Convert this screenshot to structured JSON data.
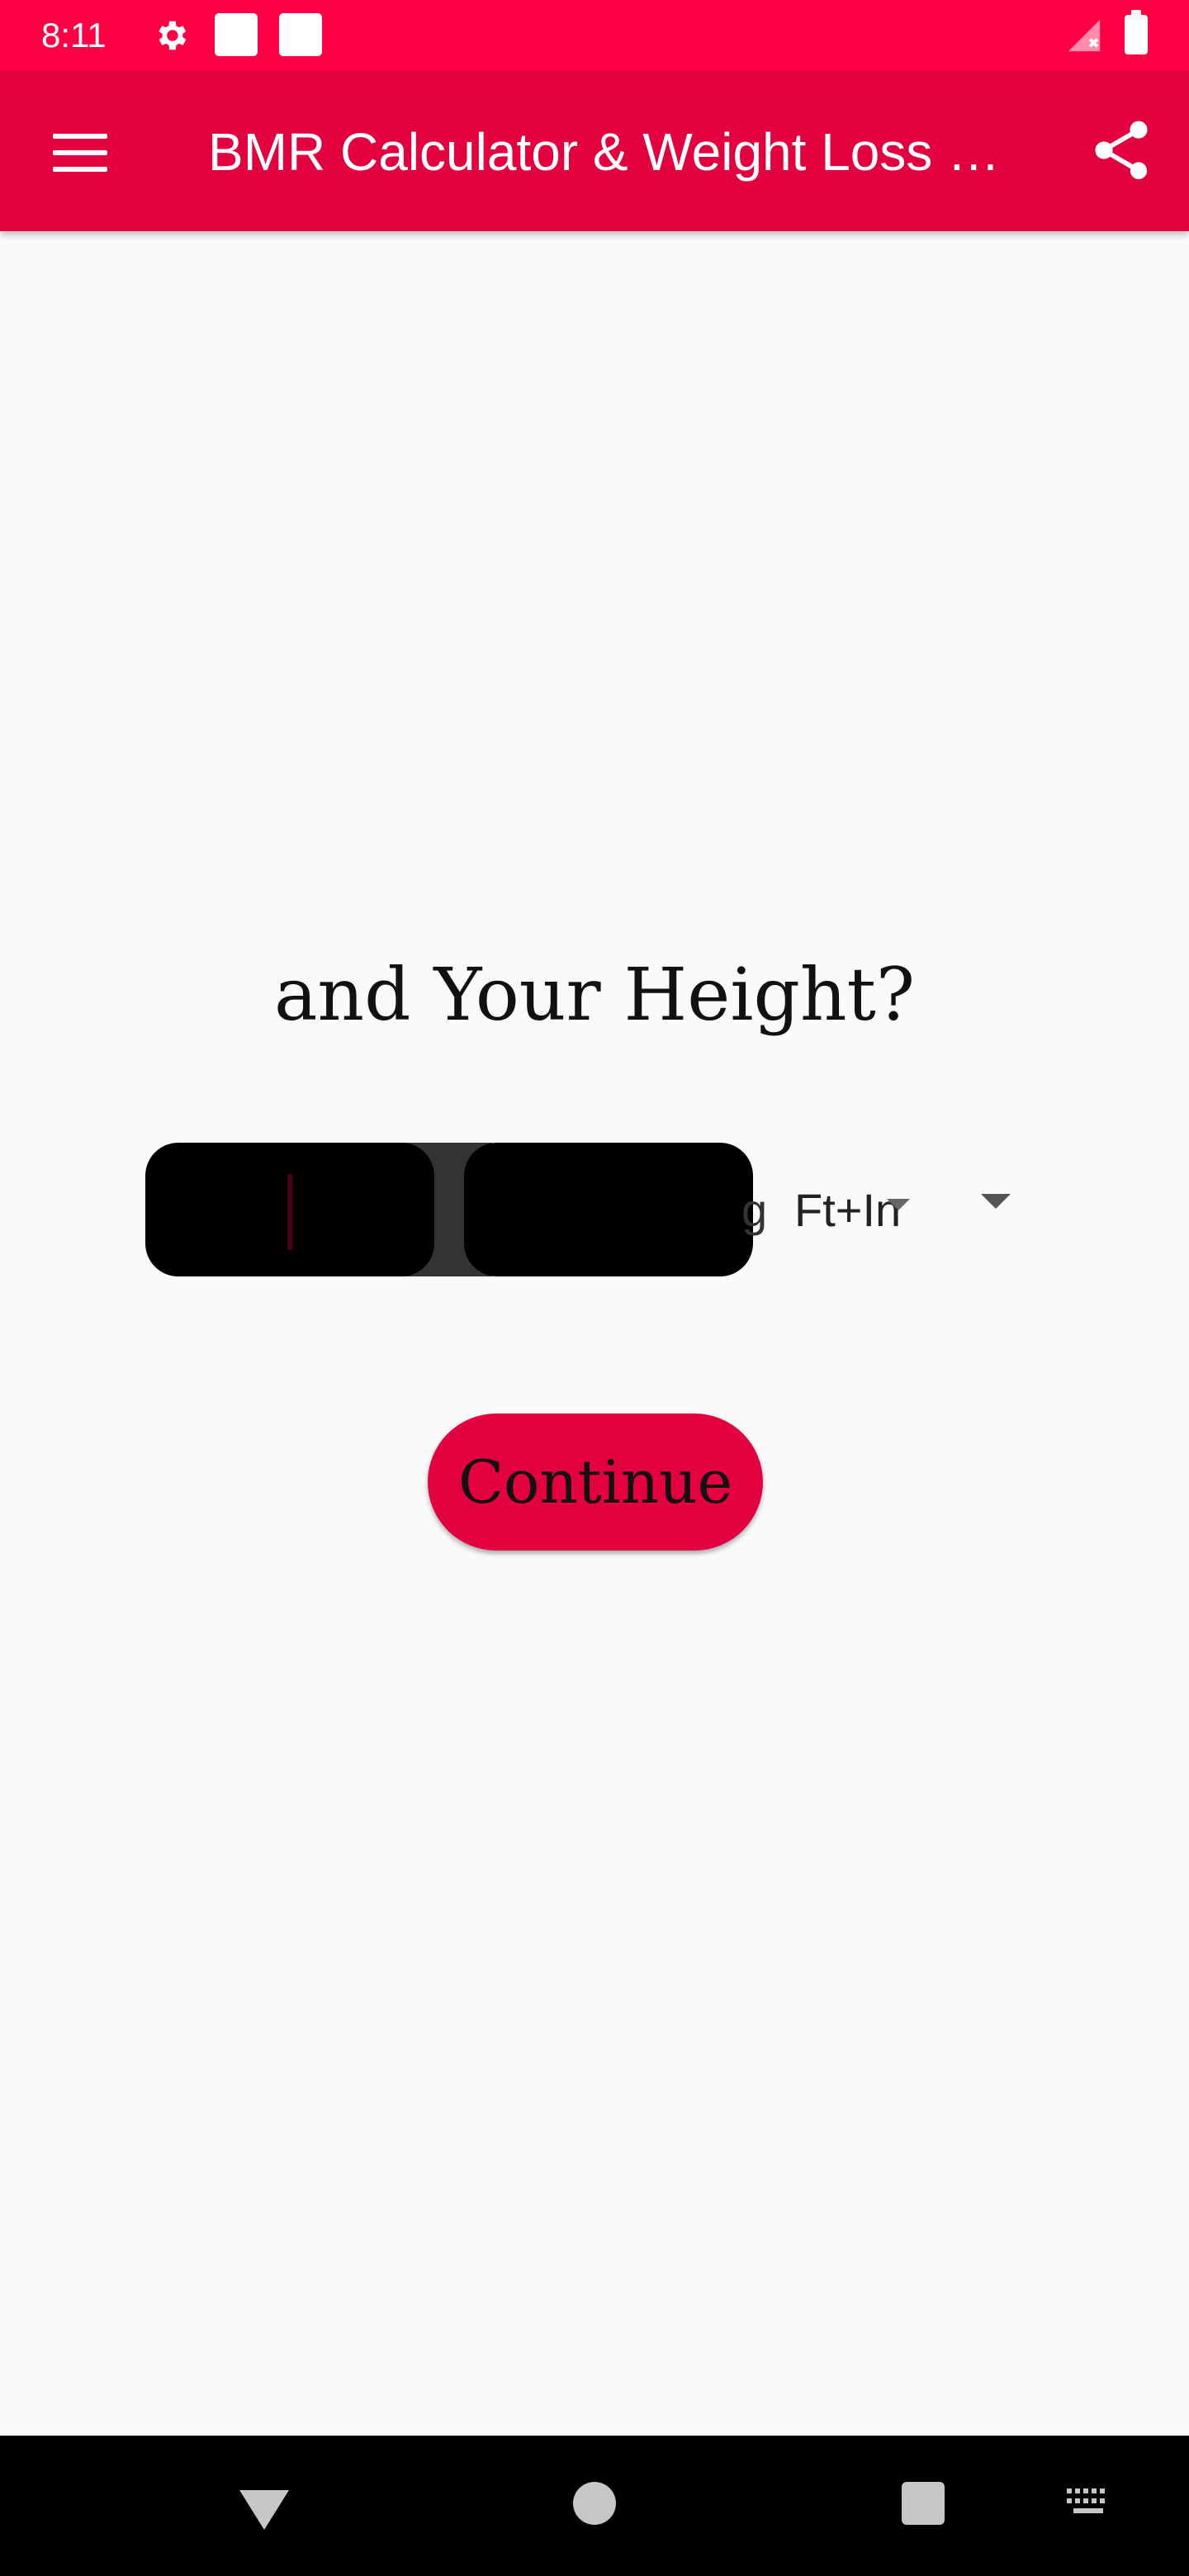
{
  "status_bar": {
    "time": "8:11",
    "icons": [
      "gear-icon",
      "notification-square-icon",
      "notification-square-icon",
      "signal-off-icon",
      "battery-icon"
    ],
    "color": "#ff0044"
  },
  "app_bar": {
    "title": "BMR Calculator & Weight Loss Planner",
    "menu_icon": "hamburger-menu-icon",
    "share_icon": "share-icon",
    "color": "#e2003f"
  },
  "main": {
    "question": "and Your Height?",
    "height_inputs": {
      "feet_value": "",
      "inches_value": ""
    },
    "unit_clipped_text": "g",
    "unit_selected": "Ft+In",
    "continue_label": "Continue"
  },
  "nav_bar": {
    "icons": [
      "back-triangle-icon",
      "home-circle-icon",
      "recents-square-icon",
      "keyboard-icon"
    ]
  }
}
